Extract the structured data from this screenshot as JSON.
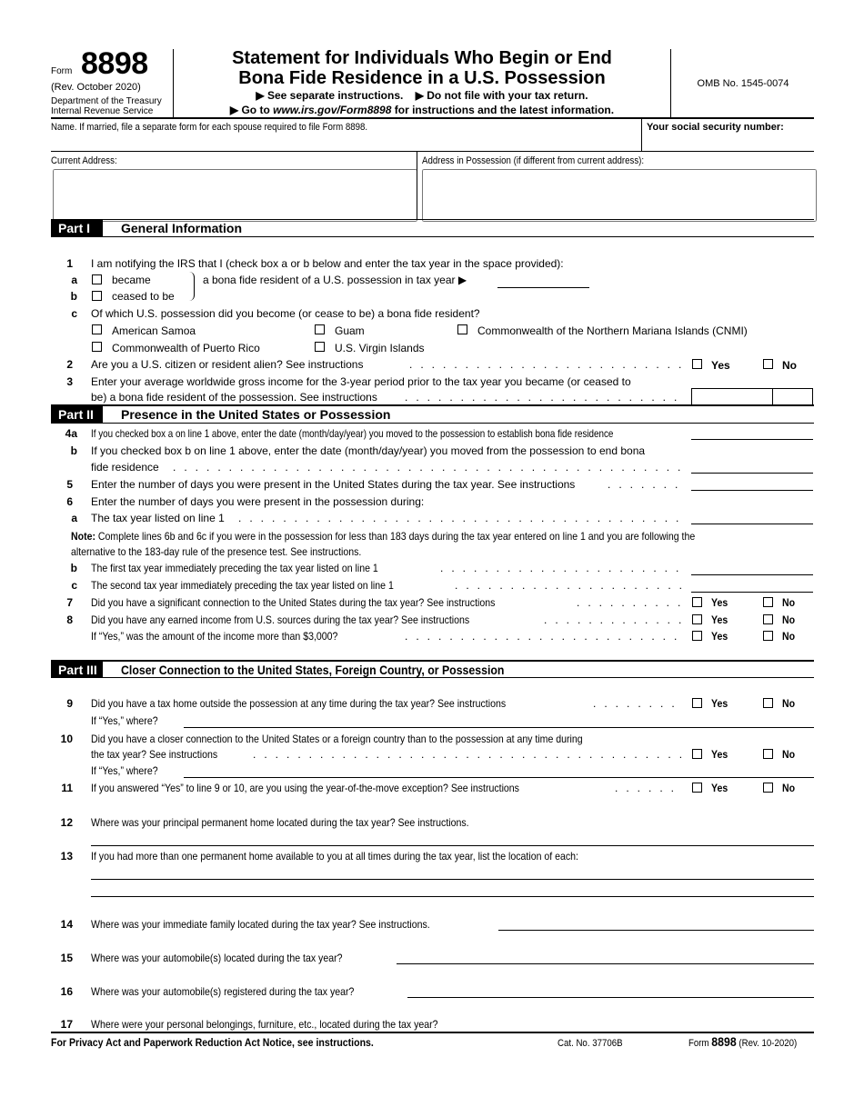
{
  "header": {
    "form_label": "Form",
    "form_number": "8898",
    "revision": "(Rev. October 2020)",
    "department": "Department of the Treasury",
    "agency": "Internal Revenue Service",
    "title_line1": "Statement for Individuals Who Begin or End",
    "title_line2": "Bona Fide Residence in a U.S. Possession",
    "instr1": "▶ See separate instructions.",
    "instr2": "▶ Do not file with your tax return.",
    "goto_prefix": "▶ Go to ",
    "goto_url": "www.irs.gov/Form8898",
    "goto_suffix": " for instructions and the latest information.",
    "omb": "OMB No. 1545-0074"
  },
  "identity": {
    "name_label": "Name. If married, file a separate form for each spouse required to file Form 8898.",
    "name_value": "",
    "ssn_label": "Your social security number:",
    "ssn_value": "",
    "current_address_label": "Current Address:",
    "current_address_value": "",
    "possession_address_label": "Address in Possession (if different from current address):",
    "possession_address_value": ""
  },
  "part1": {
    "badge": "Part I",
    "title": "General Information",
    "line1": {
      "num": "1",
      "text": "I am notifying the IRS that I (check box a or b below and enter the tax year in the space provided):"
    },
    "line1a": {
      "num": "a",
      "label": "became"
    },
    "line1b": {
      "num": "b",
      "label": "ceased to be"
    },
    "line1_bracket_text": "a bona fide resident of a U.S. possession in tax year ▶",
    "line1_tax_year": "",
    "line1c": {
      "num": "c",
      "text": "Of which U.S. possession did you become (or cease to be) a bona fide resident?"
    },
    "possessions": [
      "American Samoa",
      "Guam",
      "Commonwealth of the Northern Mariana Islands (CNMI)",
      "Commonwealth of Puerto Rico",
      "U.S. Virgin Islands"
    ],
    "line2": {
      "num": "2",
      "text": "Are you a U.S. citizen or resident alien? See instructions"
    },
    "line3": {
      "num": "3",
      "text1": "Enter your average worldwide gross income for the 3-year period prior to the tax year you became (or ceased to",
      "text2": "be) a bona fide resident of the possession. See instructions"
    },
    "line3_dollars": "",
    "line3_cents": ""
  },
  "part2": {
    "badge": "Part II",
    "title": "Presence in the United States or Possession",
    "line4a": {
      "num": "4a",
      "text": "If you checked box a on line 1 above, enter the date (month/day/year) you moved to the possession to establish bona fide residence"
    },
    "line4b": {
      "num": "b",
      "text1": "If you checked box b on line 1 above, enter the date (month/day/year) you moved from the possession to end bona",
      "text2": "fide residence"
    },
    "line5": {
      "num": "5",
      "text": "Enter the number of days you were present in the United States during the tax year. See instructions"
    },
    "line6": {
      "num": "6",
      "text": "Enter the number of days you were present in the possession during:"
    },
    "line6a": {
      "num": "a",
      "text": "The tax year listed on line 1"
    },
    "note_label": "Note:",
    "note_text1": " Complete lines 6b and 6c if you were in the possession for less than 183 days during the tax year entered on line 1 and you are following the",
    "note_text2": "alternative to the 183-day rule of the presence test. See instructions.",
    "line6b": {
      "num": "b",
      "text": "The first tax year immediately preceding the tax year listed on line 1"
    },
    "line6c": {
      "num": "c",
      "text": "The second tax year immediately preceding the tax year listed on line 1"
    },
    "line7": {
      "num": "7",
      "text": "Did you have a significant connection to the United States during the tax year? See instructions"
    },
    "line8": {
      "num": "8",
      "text": "Did you have any earned income from U.S. sources during the tax year? See instructions"
    },
    "line8_sub": {
      "text": "If “Yes,” was the amount of the income more than $3,000?"
    }
  },
  "part3": {
    "badge": "Part III",
    "title": "Closer Connection to the United States, Foreign Country, or Possession",
    "line9": {
      "num": "9",
      "text": "Did you have a tax home outside the possession at any time during the tax year? See instructions"
    },
    "line9_where": "If “Yes,” where?",
    "line10": {
      "num": "10",
      "text1": "Did you have a closer connection to the United States or a foreign country than to the possession at any time during",
      "text2": "the tax year? See instructions"
    },
    "line10_where": "If “Yes,” where?",
    "line11": {
      "num": "11",
      "text": "If you answered “Yes” to line 9 or 10, are you using the year-of-the-move exception? See instructions"
    },
    "line12": {
      "num": "12",
      "text": "Where was your principal permanent home located during the tax year? See instructions."
    },
    "line13": {
      "num": "13",
      "text": "If you had more than one permanent home available to you at all times during the tax year, list the location of each:"
    },
    "line14": {
      "num": "14",
      "text": "Where was your immediate family located during the tax year? See instructions."
    },
    "line15": {
      "num": "15",
      "text": "Where was your automobile(s) located during the tax year?"
    },
    "line16": {
      "num": "16",
      "text": "Where was your automobile(s) registered during the tax year?"
    },
    "line17": {
      "num": "17",
      "text": "Where were your personal belongings, furniture, etc., located during the tax year?"
    }
  },
  "common": {
    "yes": "Yes",
    "no": "No"
  },
  "footer": {
    "privacy": "For Privacy Act and Paperwork Reduction Act Notice, see instructions.",
    "cat": "Cat. No. 37706B",
    "form_prefix": "Form ",
    "form_number": "8898",
    "form_rev": " (Rev. 10-2020)"
  }
}
